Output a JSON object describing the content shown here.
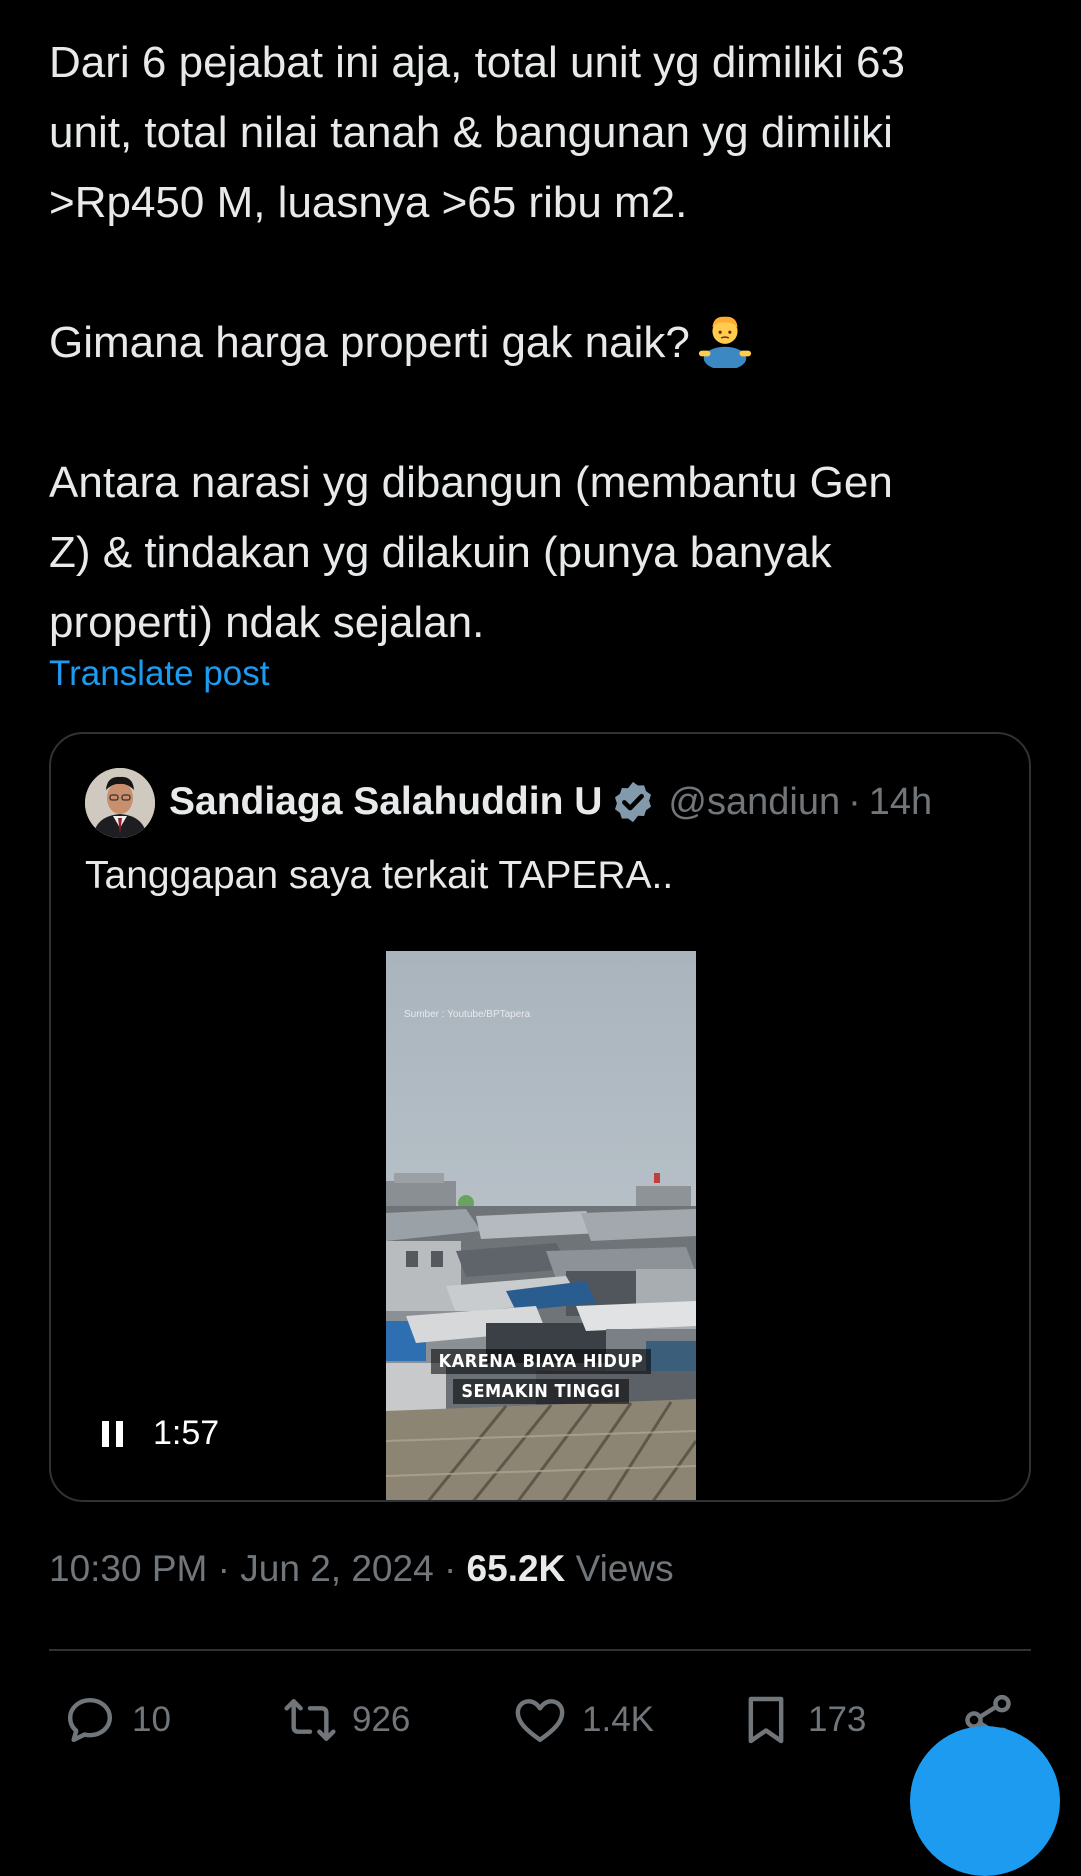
{
  "post": {
    "paragraphs": [
      [
        "Dari 6 pejabat ini aja, total unit yg dimiliki 63",
        "unit, total nilai tanah & bangunan yg dimiliki",
        ">Rp450 M, luasnya >65 ribu m2."
      ],
      [
        "Gimana harga properti gak naik?"
      ],
      [
        "Antara narasi yg dibangun (membantu Gen",
        "Z) & tindakan yg dilakuin (punya banyak",
        "properti) ndak sejalan."
      ]
    ],
    "emoji": "person-shrugging",
    "translate_label": "Translate post"
  },
  "quote": {
    "name": "Sandiaga Salahuddin U",
    "handle": "@sandiun",
    "separator": "·",
    "time": "14h",
    "text": "Tanggapan saya terkait TAPERA..",
    "video": {
      "source_text": "Sumber : Youtube/BPTapera",
      "caption_line1": "KARENA BIAYA HIDUP",
      "caption_line2": "SEMAKIN TINGGI",
      "duration": "1:57",
      "state": "playing"
    }
  },
  "meta": {
    "time": "10:30 PM",
    "sep1": "·",
    "date": "Jun 2, 2024",
    "sep2": "·",
    "views_count": "65.2K",
    "views_label": "Views"
  },
  "actions": {
    "replies": "10",
    "reposts": "926",
    "likes": "1.4K",
    "bookmarks": "173"
  },
  "colors": {
    "background": "#000000",
    "text": "#e7e9ea",
    "muted": "#71767b",
    "accent": "#1d9bf0",
    "border": "#2f3336"
  }
}
